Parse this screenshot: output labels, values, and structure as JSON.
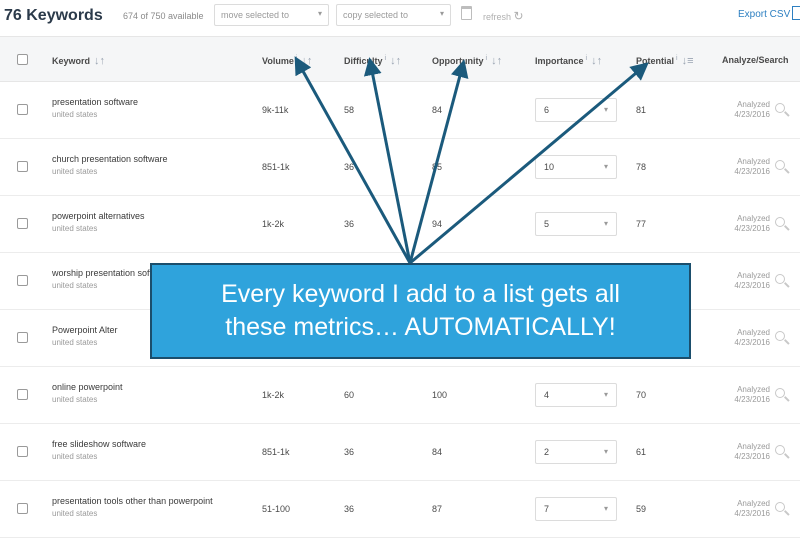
{
  "toolbar": {
    "count": "76 Keywords",
    "available": "674 of 750 available",
    "move_selected": "move selected to",
    "copy_selected": "copy selected to",
    "refresh": "refresh",
    "export": "Export CSV"
  },
  "columns": [
    "Keyword",
    "Volume",
    "Difficulty",
    "Opportunity",
    "Importance",
    "Potential",
    "Analyze/Search"
  ],
  "rows": [
    {
      "keyword": "presentation software",
      "location": "united states",
      "volume": "9k-11k",
      "difficulty": "58",
      "opportunity": "84",
      "importance": "6",
      "potential": "81",
      "analyzed": "Analyzed",
      "date": "4/23/2016"
    },
    {
      "keyword": "church presentation software",
      "location": "united states",
      "volume": "851-1k",
      "difficulty": "36",
      "opportunity": "85",
      "importance": "10",
      "potential": "78",
      "analyzed": "Analyzed",
      "date": "4/23/2016"
    },
    {
      "keyword": "powerpoint alternatives",
      "location": "united states",
      "volume": "1k-2k",
      "difficulty": "36",
      "opportunity": "94",
      "importance": "5",
      "potential": "77",
      "analyzed": "Analyzed",
      "date": "4/23/2016"
    },
    {
      "keyword": "worship presentation software",
      "location": "united states",
      "volume": "",
      "difficulty": "",
      "opportunity": "",
      "importance": "",
      "potential": "",
      "analyzed": "Analyzed",
      "date": "4/23/2016"
    },
    {
      "keyword": "Powerpoint Alter",
      "location": "united states",
      "volume": "",
      "difficulty": "",
      "opportunity": "",
      "importance": "",
      "potential": "",
      "analyzed": "Analyzed",
      "date": "4/23/2016"
    },
    {
      "keyword": "online powerpoint",
      "location": "united states",
      "volume": "1k-2k",
      "difficulty": "60",
      "opportunity": "100",
      "importance": "4",
      "potential": "70",
      "analyzed": "Analyzed",
      "date": "4/23/2016"
    },
    {
      "keyword": "free slideshow software",
      "location": "united states",
      "volume": "851-1k",
      "difficulty": "36",
      "opportunity": "84",
      "importance": "2",
      "potential": "61",
      "analyzed": "Analyzed",
      "date": "4/23/2016"
    },
    {
      "keyword": "presentation tools other than powerpoint",
      "location": "united states",
      "volume": "51-100",
      "difficulty": "36",
      "opportunity": "87",
      "importance": "7",
      "potential": "59",
      "analyzed": "Analyzed",
      "date": "4/23/2016"
    }
  ],
  "callout": {
    "line1": "Every keyword I add to a list gets all",
    "line2": "these metrics… AUTOMATICALLY!"
  },
  "colors": {
    "accent": "#2d7fc1",
    "callout_bg": "#2fa3dc",
    "arrow": "#1b5a7c"
  }
}
